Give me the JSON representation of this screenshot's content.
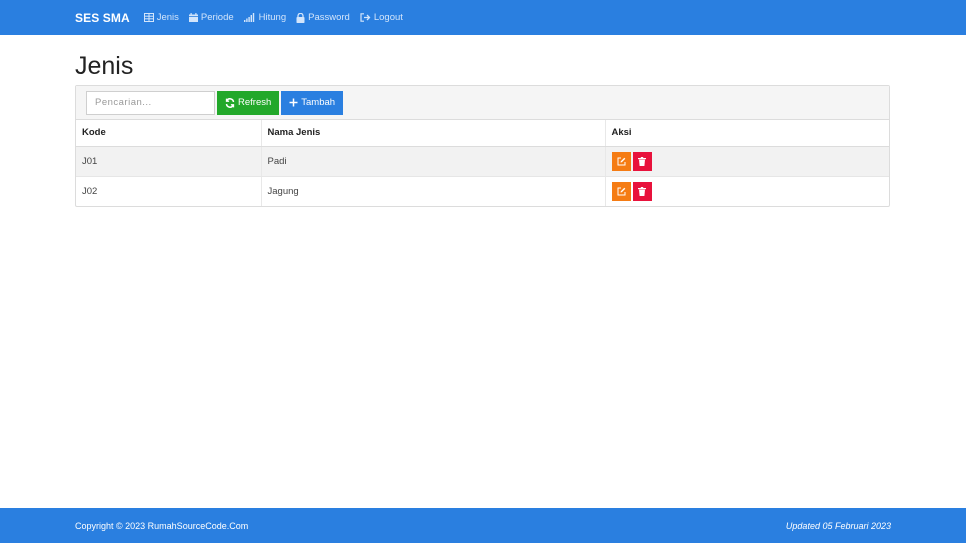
{
  "navbar": {
    "brand": "SES SMA",
    "items": [
      {
        "label": "Jenis",
        "icon": "table-icon"
      },
      {
        "label": "Periode",
        "icon": "calendar-icon"
      },
      {
        "label": "Hitung",
        "icon": "signal-icon"
      },
      {
        "label": "Password",
        "icon": "lock-icon"
      },
      {
        "label": "Logout",
        "icon": "logout-icon"
      }
    ],
    "bg_color": "#2a7fe0"
  },
  "page": {
    "title": "Jenis"
  },
  "toolbar": {
    "search_placeholder": "Pencarian...",
    "search_value": "",
    "refresh_label": "Refresh",
    "tambah_label": "Tambah"
  },
  "table": {
    "headers": [
      "Kode",
      "Nama Jenis",
      "Aksi"
    ],
    "rows": [
      {
        "kode": "J01",
        "nama": "Padi"
      },
      {
        "kode": "J02",
        "nama": "Jagung"
      }
    ]
  },
  "footer": {
    "copyright": "Copyright © 2023 RumahSourceCode.Com",
    "updated": "Updated 05 Februari 2023"
  },
  "colors": {
    "primary": "#2a7fe0",
    "success": "#22a82a",
    "warning": "#f57c14",
    "danger": "#e8123c"
  }
}
